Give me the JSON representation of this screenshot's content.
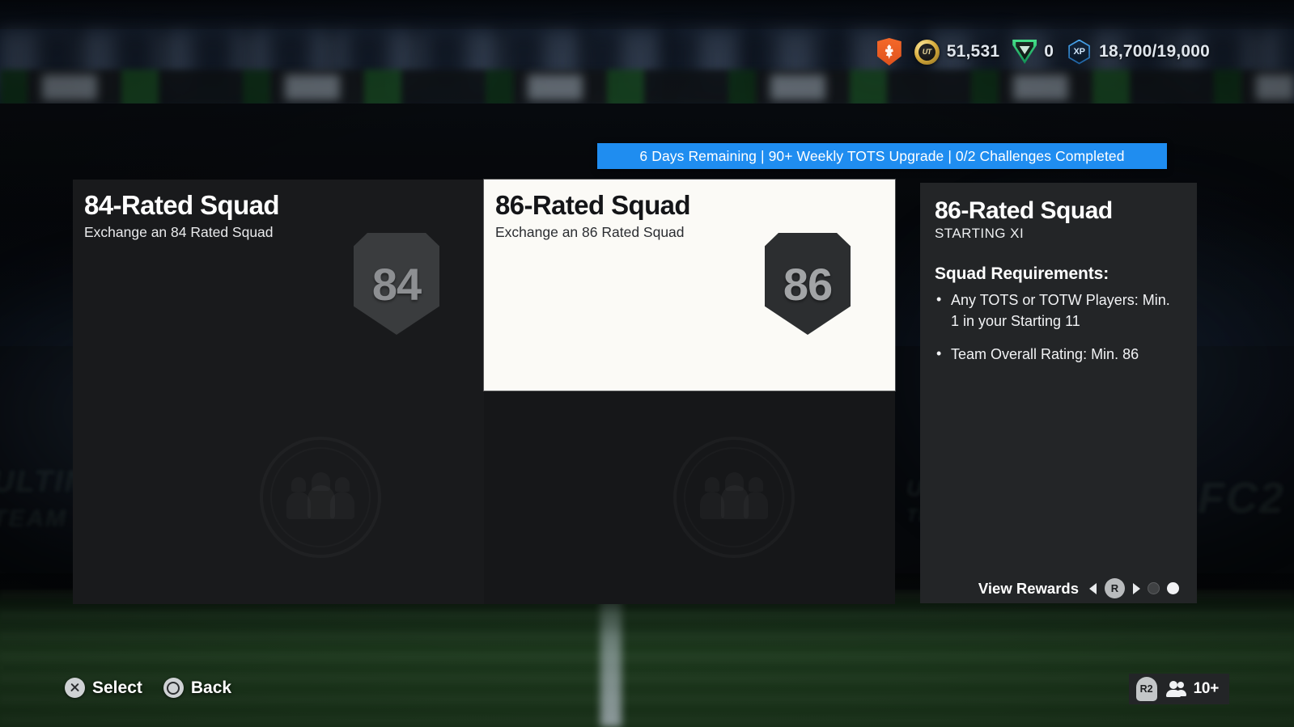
{
  "hud": {
    "club_crest_icon": "club-crest-icon",
    "coin_icon": "ut-coin-icon",
    "coins": "51,531",
    "points_icon": "fc-points-icon",
    "points": "0",
    "xp_icon": "xp-icon",
    "xp_label": "XP",
    "xp": "18,700/19,000"
  },
  "banner": {
    "text": "6 Days Remaining | 90+ Weekly TOTS Upgrade | 0/2 Challenges Completed",
    "color": "#1f8df0"
  },
  "cards": [
    {
      "title": "84-Rated Squad",
      "subtitle": "Exchange an 84 Rated Squad",
      "rating": "84",
      "selected": false
    },
    {
      "title": "86-Rated Squad",
      "subtitle": "Exchange an 86 Rated Squad",
      "rating": "86",
      "selected": true
    }
  ],
  "panel": {
    "title": "86-Rated Squad",
    "subtitle": "STARTING XI",
    "requirements_heading": "Squad Requirements:",
    "requirements": [
      "Any TOTS or TOTW Players: Min. 1 in your Starting 11",
      "Team Overall Rating: Min. 86"
    ],
    "footer": {
      "view_rewards_label": "View Rewards",
      "left_arrow_icon": "arrow-left-icon",
      "bumper_label": "R",
      "right_arrow_icon": "arrow-right-icon",
      "page_dots": [
        "off",
        "on"
      ]
    }
  },
  "bottom_bar": {
    "actions": [
      {
        "button_icon": "cross-button-icon",
        "label": "Select"
      },
      {
        "button_icon": "circle-button-icon",
        "label": "Back"
      }
    ],
    "online": {
      "trigger_label": "R2",
      "people_icon": "people-icon",
      "count": "10+"
    }
  }
}
